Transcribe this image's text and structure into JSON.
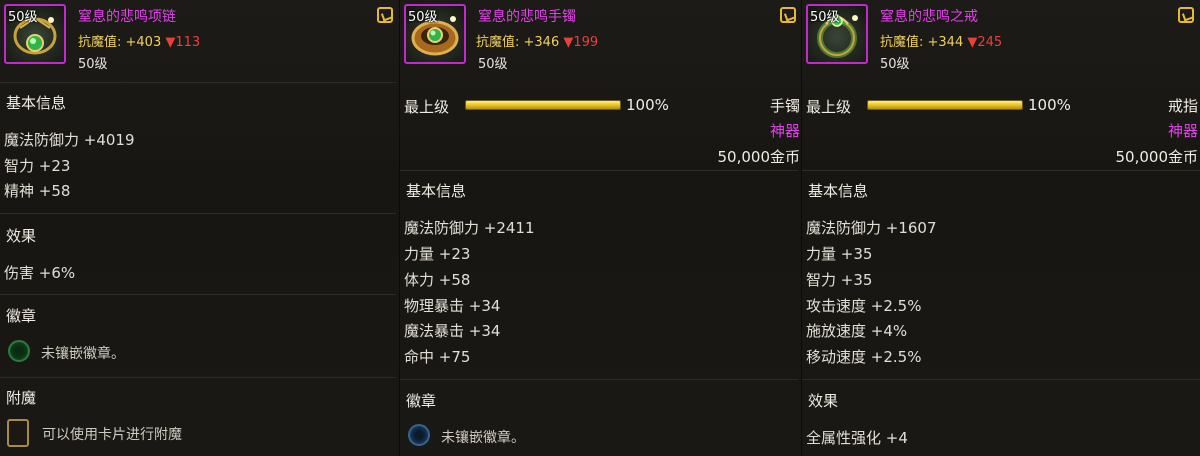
{
  "items": [
    {
      "level_tag": "50级",
      "name": "窒息的悲鸣项链",
      "resist_label": "抗魔值: ",
      "resist_value": "+403",
      "resist_diff": "▼113",
      "req_level": "50级",
      "basic_title": "基本信息",
      "stats": [
        "魔法防御力 +4019",
        "智力 +23",
        "精神 +58"
      ],
      "effect_title": "效果",
      "effect_text": "伤害 +6%",
      "emblem_title": "徽章",
      "emblem_text": "未镶嵌徽章。",
      "enchant_title": "附魔",
      "enchant_text": "可以使用卡片进行附魔"
    },
    {
      "level_tag": "50级",
      "name": "窒息的悲鸣手镯",
      "resist_label": "抗魔值: ",
      "resist_value": "+346",
      "resist_diff": "▼199",
      "req_level": "50级",
      "tier": "最上级",
      "progress": 100,
      "progress_text": "100%",
      "slot_type": "手镯",
      "rarity": "神器",
      "price": "50,000金币",
      "basic_title": "基本信息",
      "stats": [
        "魔法防御力 +2411",
        "力量 +23",
        "体力 +58",
        "物理暴击 +34",
        "魔法暴击 +34",
        "命中 +75"
      ],
      "emblem_title": "徽章",
      "emblem_text": "未镶嵌徽章。"
    },
    {
      "level_tag": "50级",
      "name": "窒息的悲鸣之戒",
      "resist_label": "抗魔值: ",
      "resist_value": "+344",
      "resist_diff": "▼245",
      "req_level": "50级",
      "tier": "最上级",
      "progress": 100,
      "progress_text": "100%",
      "slot_type": "戒指",
      "rarity": "神器",
      "price": "50,000金币",
      "basic_title": "基本信息",
      "stats": [
        "魔法防御力 +1607",
        "力量 +35",
        "智力 +35",
        "攻击速度 +2.5%",
        "施放速度 +4%",
        "移动速度 +2.5%"
      ],
      "effect_title": "效果",
      "effect_text": "全属性强化 +4"
    }
  ],
  "colors": {
    "item_name": "#e040e8",
    "resist": "#f0d15a",
    "resist_down": "#e8403a",
    "bar_fill": "#e8c020",
    "icon_border": "#c22ac9"
  },
  "icons": [
    "necklace-icon",
    "bracelet-icon",
    "ring-icon",
    "compare-icon",
    "emblem-slot-icon",
    "card-slot-icon"
  ]
}
